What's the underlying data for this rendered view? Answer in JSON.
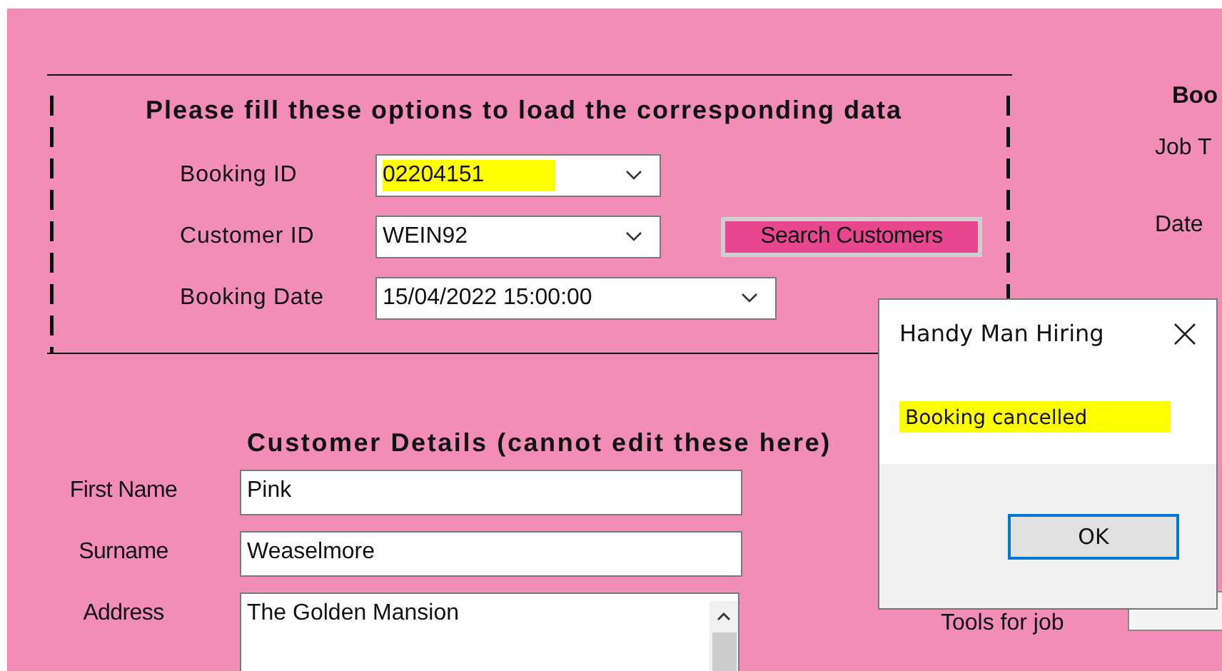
{
  "search_panel": {
    "heading": "Please fill these options to load the corresponding data",
    "fields": [
      {
        "label": "Booking ID",
        "value": "02204151",
        "kind": "dropdown",
        "highlighted": true
      },
      {
        "label": "Customer ID",
        "value": "WEIN92",
        "kind": "dropdown",
        "highlighted": false
      },
      {
        "label": "Booking Date",
        "value": "15/04/2022 15:00:00",
        "kind": "date-picker",
        "highlighted": false
      }
    ],
    "search_button": "Search Customers"
  },
  "booking_details": {
    "heading": "Boo",
    "labels": [
      "Job T",
      "Date"
    ],
    "tools_label": "Tools for job"
  },
  "customer_details": {
    "heading": "Customer Details (cannot edit these here)",
    "fields": [
      {
        "label": "First Name",
        "value": "Pink",
        "kind": "text"
      },
      {
        "label": "Surname",
        "value": "Weaselmore",
        "kind": "text"
      },
      {
        "label": "Address",
        "value": "The Golden Mansion",
        "kind": "multiline"
      }
    ]
  },
  "dialog": {
    "title": "Handy Man Hiring",
    "message": "Booking cancelled",
    "message_highlighted": true,
    "button": "OK"
  }
}
